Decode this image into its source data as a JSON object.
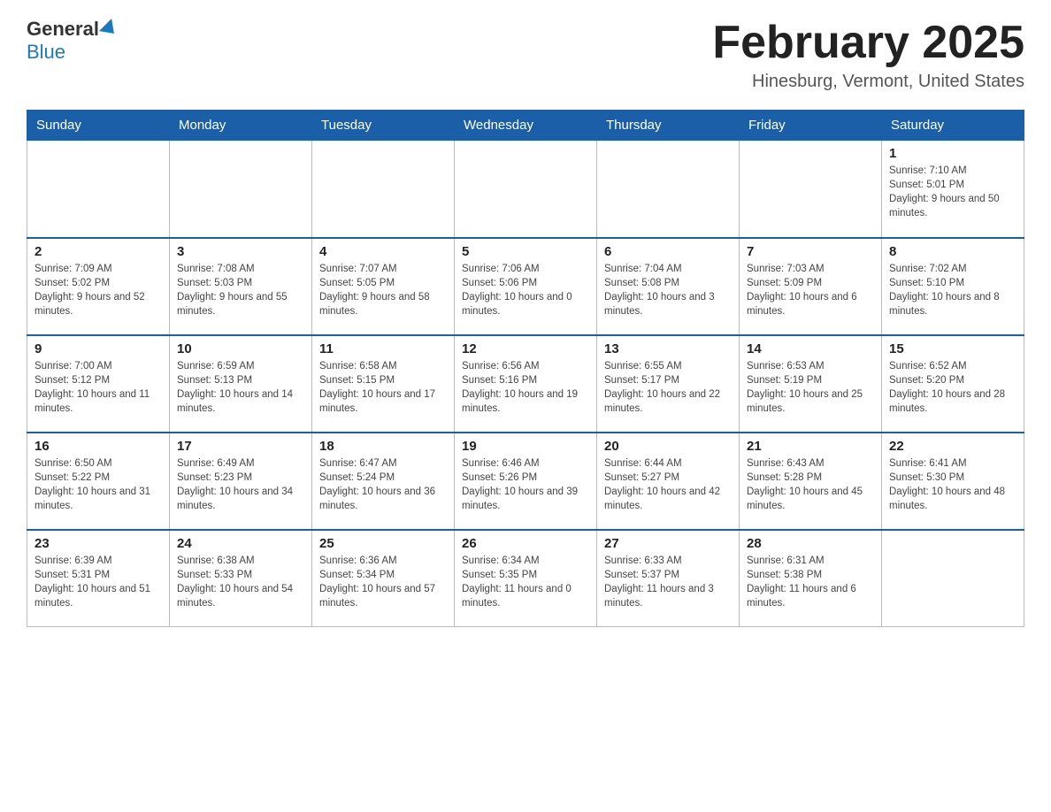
{
  "logo": {
    "general": "General",
    "blue": "Blue"
  },
  "header": {
    "title": "February 2025",
    "location": "Hinesburg, Vermont, United States"
  },
  "weekdays": [
    "Sunday",
    "Monday",
    "Tuesday",
    "Wednesday",
    "Thursday",
    "Friday",
    "Saturday"
  ],
  "weeks": [
    [
      {
        "day": "",
        "info": ""
      },
      {
        "day": "",
        "info": ""
      },
      {
        "day": "",
        "info": ""
      },
      {
        "day": "",
        "info": ""
      },
      {
        "day": "",
        "info": ""
      },
      {
        "day": "",
        "info": ""
      },
      {
        "day": "1",
        "info": "Sunrise: 7:10 AM\nSunset: 5:01 PM\nDaylight: 9 hours and 50 minutes."
      }
    ],
    [
      {
        "day": "2",
        "info": "Sunrise: 7:09 AM\nSunset: 5:02 PM\nDaylight: 9 hours and 52 minutes."
      },
      {
        "day": "3",
        "info": "Sunrise: 7:08 AM\nSunset: 5:03 PM\nDaylight: 9 hours and 55 minutes."
      },
      {
        "day": "4",
        "info": "Sunrise: 7:07 AM\nSunset: 5:05 PM\nDaylight: 9 hours and 58 minutes."
      },
      {
        "day": "5",
        "info": "Sunrise: 7:06 AM\nSunset: 5:06 PM\nDaylight: 10 hours and 0 minutes."
      },
      {
        "day": "6",
        "info": "Sunrise: 7:04 AM\nSunset: 5:08 PM\nDaylight: 10 hours and 3 minutes."
      },
      {
        "day": "7",
        "info": "Sunrise: 7:03 AM\nSunset: 5:09 PM\nDaylight: 10 hours and 6 minutes."
      },
      {
        "day": "8",
        "info": "Sunrise: 7:02 AM\nSunset: 5:10 PM\nDaylight: 10 hours and 8 minutes."
      }
    ],
    [
      {
        "day": "9",
        "info": "Sunrise: 7:00 AM\nSunset: 5:12 PM\nDaylight: 10 hours and 11 minutes."
      },
      {
        "day": "10",
        "info": "Sunrise: 6:59 AM\nSunset: 5:13 PM\nDaylight: 10 hours and 14 minutes."
      },
      {
        "day": "11",
        "info": "Sunrise: 6:58 AM\nSunset: 5:15 PM\nDaylight: 10 hours and 17 minutes."
      },
      {
        "day": "12",
        "info": "Sunrise: 6:56 AM\nSunset: 5:16 PM\nDaylight: 10 hours and 19 minutes."
      },
      {
        "day": "13",
        "info": "Sunrise: 6:55 AM\nSunset: 5:17 PM\nDaylight: 10 hours and 22 minutes."
      },
      {
        "day": "14",
        "info": "Sunrise: 6:53 AM\nSunset: 5:19 PM\nDaylight: 10 hours and 25 minutes."
      },
      {
        "day": "15",
        "info": "Sunrise: 6:52 AM\nSunset: 5:20 PM\nDaylight: 10 hours and 28 minutes."
      }
    ],
    [
      {
        "day": "16",
        "info": "Sunrise: 6:50 AM\nSunset: 5:22 PM\nDaylight: 10 hours and 31 minutes."
      },
      {
        "day": "17",
        "info": "Sunrise: 6:49 AM\nSunset: 5:23 PM\nDaylight: 10 hours and 34 minutes."
      },
      {
        "day": "18",
        "info": "Sunrise: 6:47 AM\nSunset: 5:24 PM\nDaylight: 10 hours and 36 minutes."
      },
      {
        "day": "19",
        "info": "Sunrise: 6:46 AM\nSunset: 5:26 PM\nDaylight: 10 hours and 39 minutes."
      },
      {
        "day": "20",
        "info": "Sunrise: 6:44 AM\nSunset: 5:27 PM\nDaylight: 10 hours and 42 minutes."
      },
      {
        "day": "21",
        "info": "Sunrise: 6:43 AM\nSunset: 5:28 PM\nDaylight: 10 hours and 45 minutes."
      },
      {
        "day": "22",
        "info": "Sunrise: 6:41 AM\nSunset: 5:30 PM\nDaylight: 10 hours and 48 minutes."
      }
    ],
    [
      {
        "day": "23",
        "info": "Sunrise: 6:39 AM\nSunset: 5:31 PM\nDaylight: 10 hours and 51 minutes."
      },
      {
        "day": "24",
        "info": "Sunrise: 6:38 AM\nSunset: 5:33 PM\nDaylight: 10 hours and 54 minutes."
      },
      {
        "day": "25",
        "info": "Sunrise: 6:36 AM\nSunset: 5:34 PM\nDaylight: 10 hours and 57 minutes."
      },
      {
        "day": "26",
        "info": "Sunrise: 6:34 AM\nSunset: 5:35 PM\nDaylight: 11 hours and 0 minutes."
      },
      {
        "day": "27",
        "info": "Sunrise: 6:33 AM\nSunset: 5:37 PM\nDaylight: 11 hours and 3 minutes."
      },
      {
        "day": "28",
        "info": "Sunrise: 6:31 AM\nSunset: 5:38 PM\nDaylight: 11 hours and 6 minutes."
      },
      {
        "day": "",
        "info": ""
      }
    ]
  ]
}
